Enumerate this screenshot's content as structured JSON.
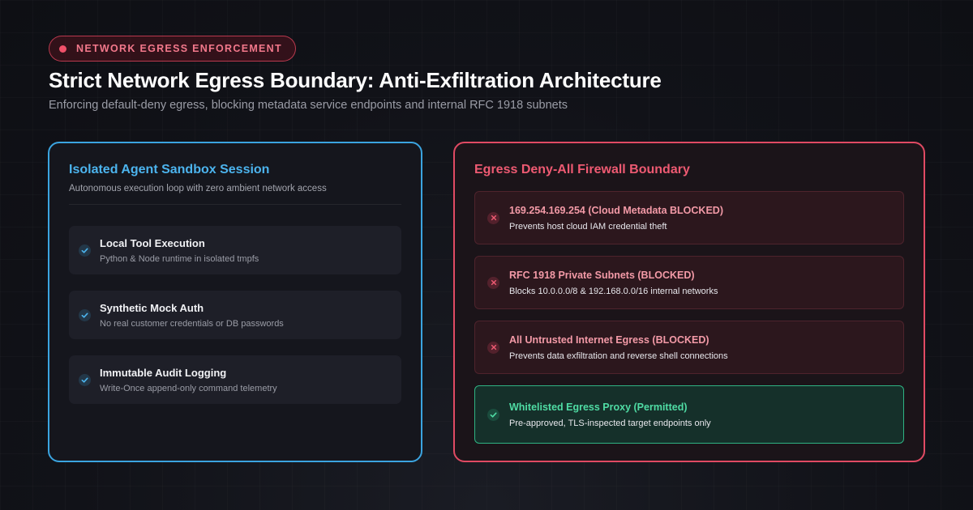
{
  "header": {
    "badge": "NETWORK EGRESS ENFORCEMENT",
    "title": "Strict Network Egress Boundary: Anti-Exfiltration Architecture",
    "subtitle": "Enforcing default-deny egress, blocking metadata service endpoints and internal RFC 1918 subnets"
  },
  "sandbox": {
    "title": "Isolated Agent Sandbox Session",
    "description": "Autonomous execution loop with zero ambient network access",
    "items": [
      {
        "title": "Local Tool Execution",
        "subtitle": "Python & Node runtime in isolated tmpfs",
        "icon": "check-icon"
      },
      {
        "title": "Synthetic Mock Auth",
        "subtitle": "No real customer credentials or DB passwords",
        "icon": "check-icon"
      },
      {
        "title": "Immutable Audit Logging",
        "subtitle": "Write-Once append-only command telemetry",
        "icon": "check-icon"
      }
    ]
  },
  "firewall": {
    "title": "Egress Deny-All Firewall Boundary",
    "rules": [
      {
        "title": "169.254.169.254 (Cloud Metadata BLOCKED)",
        "subtitle": "Prevents host cloud IAM credential theft",
        "status": "blocked",
        "icon": "x-icon"
      },
      {
        "title": "RFC 1918 Private Subnets (BLOCKED)",
        "subtitle": "Blocks 10.0.0.0/8 & 192.168.0.0/16 internal networks",
        "status": "blocked",
        "icon": "x-icon"
      },
      {
        "title": "All Untrusted Internet Egress (BLOCKED)",
        "subtitle": "Prevents data exfiltration and reverse shell connections",
        "status": "blocked",
        "icon": "x-icon"
      },
      {
        "title": "Whitelisted Egress Proxy (Permitted)",
        "subtitle": "Pre-approved, TLS-inspected target endpoints only",
        "status": "permitted",
        "icon": "check-icon"
      }
    ]
  },
  "colors": {
    "sandbox_accent": "#3ba4e0",
    "firewall_accent": "#e04a63",
    "permitted_accent": "#2fb383",
    "badge_text": "#f2788b"
  }
}
